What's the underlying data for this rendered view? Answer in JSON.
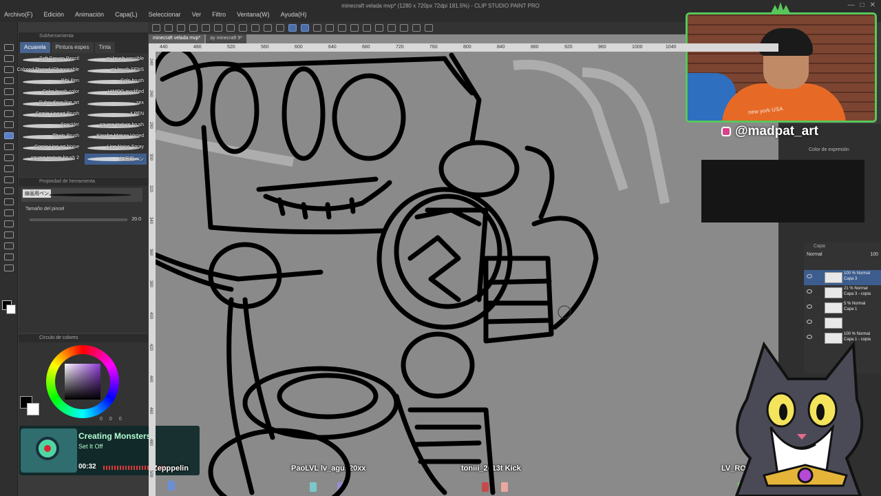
{
  "window": {
    "title": "minecraft velada mvp* (1280 x 720px 72dpi 181.5%)  - CLIP STUDIO PAINT PRO",
    "controls": [
      "—",
      "□",
      "✕"
    ]
  },
  "menu": [
    "Archivo(F)",
    "Edición",
    "Animación",
    "Capa(L)",
    "Seleccionar",
    "Ver",
    "Filtro",
    "Ventana(W)",
    "Ayuda(H)"
  ],
  "subtool": {
    "title": "Subherramienta",
    "tabs": [
      "Acuarela",
      "Pintura espes",
      "Tinta"
    ],
    "active_tab": "Acuarela",
    "brushes": [
      {
        "name": "Soft Crayon Pencil",
        "selected": false
      },
      {
        "name": "mi brush sensible",
        "selected": false
      },
      {
        "name": "Colored Thread (Changeable",
        "selected": false
      },
      {
        "name": "mi brush SENS",
        "selected": false
      },
      {
        "name": "Bibi Pen",
        "selected": false
      },
      {
        "name": "Colo brush",
        "selected": false
      },
      {
        "name": "Color brush color",
        "selected": false
      },
      {
        "name": "HIMOG modified",
        "selected": false
      },
      {
        "name": "Subsurface line art",
        "selected": false
      },
      {
        "name": "sex",
        "selected": false
      },
      {
        "name": "Comic Lineart Brush",
        "selected": false
      },
      {
        "name": "4 PEN",
        "selected": false
      },
      {
        "name": "Speckle!",
        "selected": false
      },
      {
        "name": "square texture brush",
        "selected": false
      },
      {
        "name": "Thwip Brush",
        "selected": false
      },
      {
        "name": "Kirsche Mature Varied",
        "selected": false
      },
      {
        "name": "Comic Line art Noise",
        "selected": false
      },
      {
        "name": "Line Noise Spray",
        "selected": false
      },
      {
        "name": "square texture brush 2",
        "selected": false
      },
      {
        "name": "線画用ペン",
        "selected": true
      }
    ]
  },
  "toolprop": {
    "title": "Propiedad de herramienta",
    "preview_name": "線画用ペン",
    "size_label": "Tamaño del pincel",
    "size_value": "20.0"
  },
  "colorpanel": {
    "title": "Círculo de colores",
    "hue": "#8d3bd4",
    "values": [
      "0",
      "0",
      "0"
    ]
  },
  "doc_tabs": [
    "minecraft velada mvp*",
    "ay minecraft 9*"
  ],
  "ruler": [
    "440",
    "480",
    "520",
    "560",
    "600",
    "640",
    "680",
    "720",
    "760",
    "800",
    "840",
    "880",
    "920",
    "960",
    "1000",
    "1040"
  ],
  "vruler": [
    "240",
    "260",
    "280",
    "300",
    "320",
    "340",
    "360",
    "380",
    "400",
    "420",
    "440",
    "460",
    "480",
    "500"
  ],
  "right": {
    "expression_color_label": "Color de expresión",
    "layer_panel_title": "Capa",
    "opacity": "100",
    "blend": "Normal",
    "layers": [
      {
        "mode": "100 % Normal",
        "name": "Capa 3",
        "selected": true
      },
      {
        "mode": "21 % Normal",
        "name": "Capa 3 - copia",
        "selected": false
      },
      {
        "mode": "5 % Normal",
        "name": "Capa 1",
        "selected": false
      },
      {
        "mode": "",
        "name": "",
        "selected": false
      },
      {
        "mode": "100 % Normal",
        "name": "Capa 1 - copia",
        "selected": false
      }
    ]
  },
  "stream": {
    "handle": "@madpat_art",
    "shirt_text": "new york  USA",
    "music": {
      "song": "Creating Monsters",
      "artist": "Set It Off",
      "time": "00:32"
    },
    "chat_names": [
      {
        "text": "Zepppelin"
      },
      {
        "text": "PaoLVL lv_agus20xx"
      },
      {
        "text": "toniii_2013t Kick"
      },
      {
        "text": "LV_RODRII ew"
      }
    ]
  },
  "colors": {
    "accent": "#4c6da8",
    "webcam_border": "#58c75b",
    "canvas_bg": "#8a8a8a",
    "sketch_ink": "#000000"
  }
}
